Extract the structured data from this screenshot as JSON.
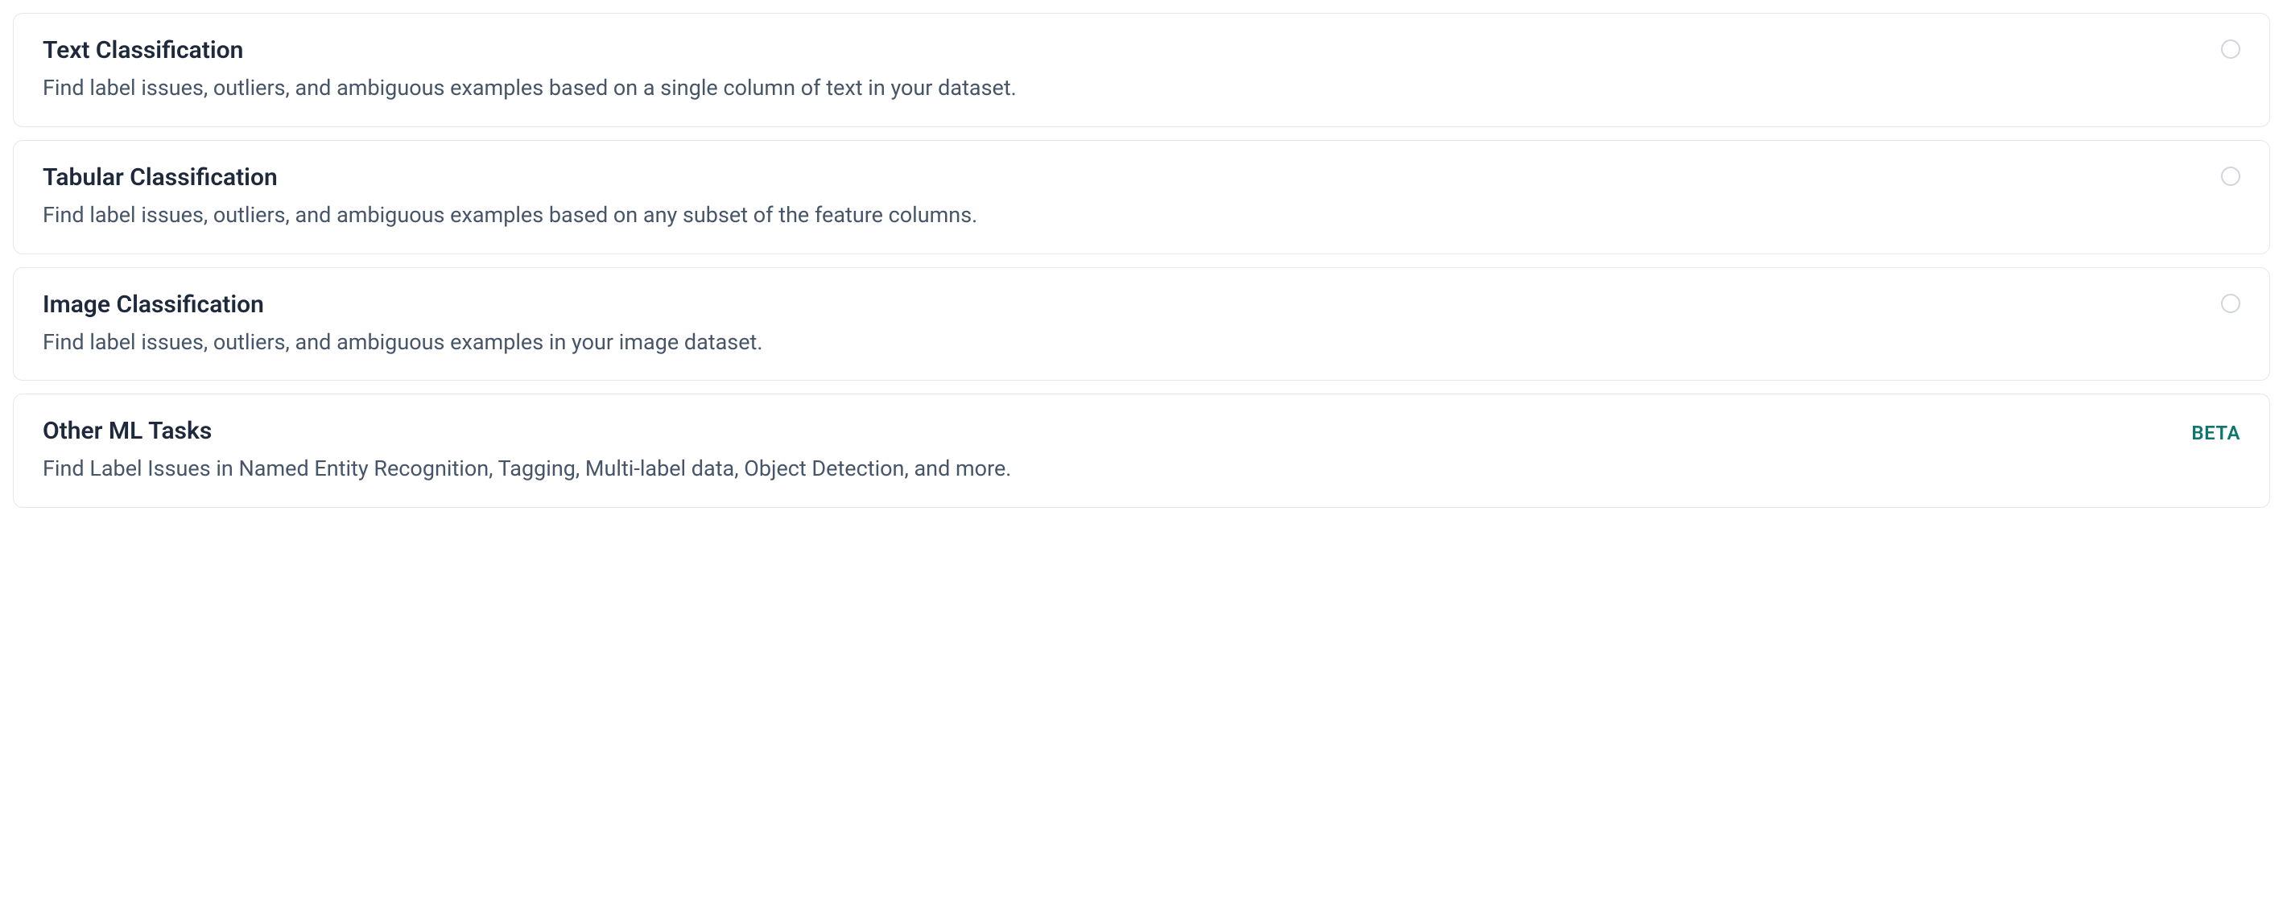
{
  "options": [
    {
      "title": "Text Classification",
      "description": "Find label issues, outliers, and ambiguous examples based on a single column of text in your dataset.",
      "badge": null,
      "has_radio": true
    },
    {
      "title": "Tabular Classification",
      "description": "Find label issues, outliers, and ambiguous examples based on any subset of the feature columns.",
      "badge": null,
      "has_radio": true
    },
    {
      "title": "Image Classification",
      "description": "Find label issues, outliers, and ambiguous examples in your image dataset.",
      "badge": null,
      "has_radio": true
    },
    {
      "title": "Other ML Tasks",
      "description": "Find Label Issues in Named Entity Recognition, Tagging, Multi-label data, Object Detection, and more.",
      "badge": "BETA",
      "has_radio": false
    }
  ]
}
